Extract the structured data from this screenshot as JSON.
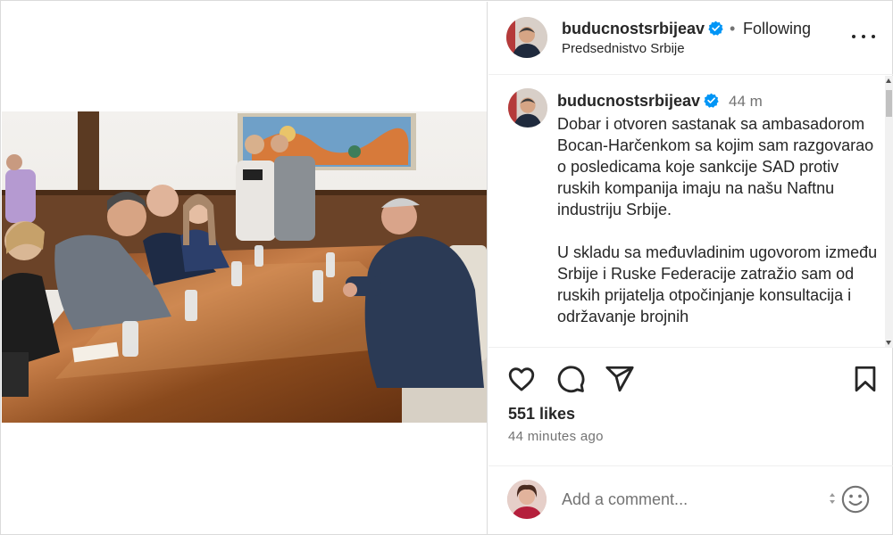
{
  "post": {
    "username": "buducnostsrbijeav",
    "follow_status": "Following",
    "location": "Predsednistvo Srbije",
    "caption_time": "44 m",
    "caption_paragraphs": [
      "Dobar i otvoren sastanak sa ambasadorom Bocan-Harčenkom sa kojim sam razgovarao o posledicama koje sankcije SAD protiv ruskih kompanija imaju na našu Naftnu industriju Srbije.",
      "U skladu sa međuvladinim ugovorom između Srbije i Ruske Federacije zatražio sam od ruskih prijatelja otpočinjanje konsultacija i održavanje brojnih"
    ],
    "likes": "551 likes",
    "time_ago": "44 minutes ago"
  },
  "comment_box": {
    "placeholder": "Add a comment..."
  },
  "icons": {
    "verified": "verified-badge-icon",
    "more": "more-options-icon",
    "like": "heart-icon",
    "comment": "comment-bubble-icon",
    "share": "paper-plane-icon",
    "save": "bookmark-icon",
    "emoji": "smiley-icon"
  },
  "colors": {
    "verified_blue": "#0095f6",
    "text": "#262626",
    "secondary_text": "#737373",
    "divider": "#efefef"
  }
}
